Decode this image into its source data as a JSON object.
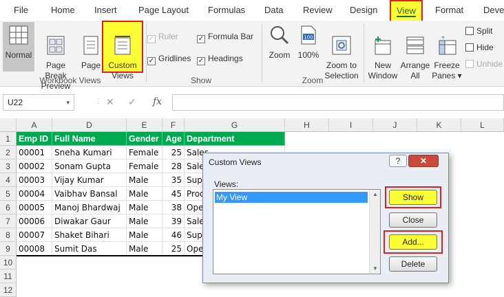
{
  "menu": {
    "tabs": [
      "File",
      "Home",
      "Insert",
      "Page Layout",
      "Formulas",
      "Data",
      "Review",
      "Design",
      "View",
      "Format",
      "Deve"
    ]
  },
  "ribbon": {
    "workbook_views": {
      "label": "Workbook Views",
      "normal": "Normal",
      "page_break": "Page Break\nPreview",
      "page_layout": "Page\nLayout",
      "custom_views": "Custom\nViews"
    },
    "show": {
      "label": "Show",
      "ruler": "Ruler",
      "gridlines": "Gridlines",
      "formula_bar": "Formula Bar",
      "headings": "Headings"
    },
    "zoom": {
      "label": "Zoom",
      "zoom": "Zoom",
      "hundred": "100%",
      "zoom_selection": "Zoom to\nSelection",
      "hundred_icon_text": "100"
    },
    "window": {
      "new_window": "New\nWindow",
      "arrange_all": "Arrange\nAll",
      "freeze_panes": "Freeze\nPanes ▾",
      "split": "Split",
      "hide": "Hide",
      "unhide": "Unhide"
    },
    "check_mark": "✓"
  },
  "formula_bar": {
    "name_box": "U22",
    "cancel": "✕",
    "enter": "✓",
    "fx": "fx",
    "more": "⋮",
    "dropdown": "▾"
  },
  "grid": {
    "columns": [
      "A",
      "D",
      "E",
      "F",
      "G",
      "H",
      "I",
      "J",
      "K",
      "L"
    ],
    "rows": [
      "1",
      "2",
      "3",
      "4",
      "5",
      "6",
      "7",
      "8",
      "9",
      "10",
      "11",
      "12"
    ],
    "headers": [
      "Emp ID",
      "Full Name",
      "Gender",
      "Age",
      "Department"
    ],
    "data": [
      [
        "00001",
        "Sneha Kumari",
        "Female",
        "25",
        "Sales"
      ],
      [
        "00002",
        "Sonam Gupta",
        "Female",
        "28",
        "Sales"
      ],
      [
        "00003",
        "Vijay Kumar",
        "Male",
        "35",
        "Sup"
      ],
      [
        "00004",
        "Vaibhav Bansal",
        "Male",
        "45",
        "Prod"
      ],
      [
        "00005",
        "Manoj Bhardwaj",
        "Male",
        "38",
        "Ope"
      ],
      [
        "00006",
        "Diwakar Gaur",
        "Male",
        "39",
        "Sale"
      ],
      [
        "00007",
        "Shaket Bihari",
        "Male",
        "46",
        "Sup"
      ],
      [
        "00008",
        "Sumit Das",
        "Male",
        "25",
        "Ope"
      ]
    ]
  },
  "dialog": {
    "title": "Custom Views",
    "help": "?",
    "close": "✕",
    "views_label": "Views:",
    "items": [
      "My View"
    ],
    "show": "Show",
    "close_btn": "Close",
    "add": "Add...",
    "delete": "Delete",
    "scroll_up": "▲",
    "scroll_down": "▼"
  }
}
